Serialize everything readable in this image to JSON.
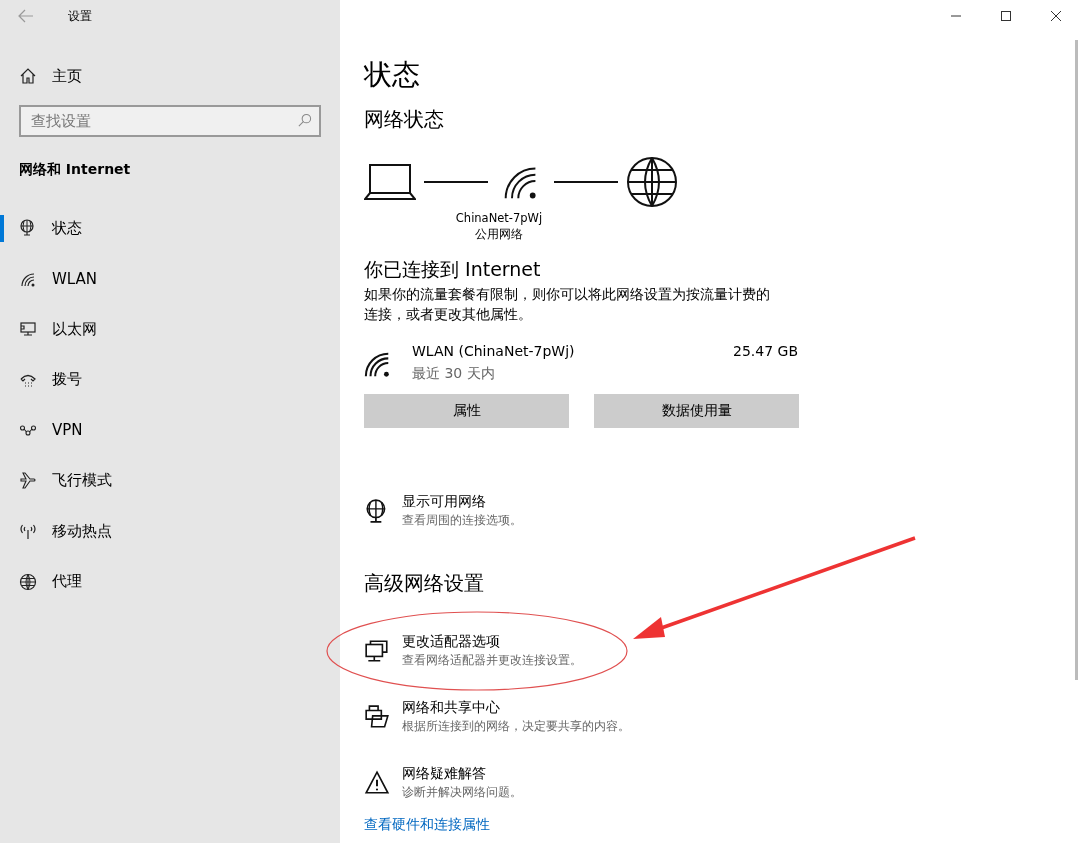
{
  "window": {
    "title": "设置"
  },
  "sidebar": {
    "home": "主页",
    "search": {
      "placeholder": "查找设置"
    },
    "section": "网络和 Internet",
    "items": [
      {
        "label": "状态",
        "kind": "status",
        "selected": true
      },
      {
        "label": "WLAN",
        "kind": "wlan",
        "selected": false
      },
      {
        "label": "以太网",
        "kind": "ethernet",
        "selected": false
      },
      {
        "label": "拨号",
        "kind": "dialup",
        "selected": false
      },
      {
        "label": "VPN",
        "kind": "vpn",
        "selected": false
      },
      {
        "label": "飞行模式",
        "kind": "airplane",
        "selected": false
      },
      {
        "label": "移动热点",
        "kind": "hotspot",
        "selected": false
      },
      {
        "label": "代理",
        "kind": "proxy",
        "selected": false
      }
    ]
  },
  "main": {
    "title": "状态",
    "network_status": {
      "heading": "网络状态",
      "network_name": "ChinaNet-7pWj",
      "network_type": "公用网络"
    },
    "connected": {
      "heading": "你已连接到 Internet",
      "description": "如果你的流量套餐有限制，则你可以将此网络设置为按流量计费的连接，或者更改其他属性。"
    },
    "usage": {
      "name": "WLAN (ChinaNet-7pWj)",
      "period": "最近 30 天内",
      "amount": "25.47 GB"
    },
    "buttons": [
      "属性",
      "数据使用量"
    ],
    "show_networks": {
      "kind": "globe",
      "title": "显示可用网络",
      "subtitle": "查看周围的连接选项。"
    },
    "advanced": {
      "heading": "高级网络设置",
      "items": [
        {
          "kind": "adapter",
          "title": "更改适配器选项",
          "subtitle": "查看网络适配器并更改连接设置。"
        },
        {
          "kind": "sharing",
          "title": "网络和共享中心",
          "subtitle": "根据所连接到的网络，决定要共享的内容。"
        },
        {
          "kind": "warning",
          "title": "网络疑难解答",
          "subtitle": "诊断并解决网络问题。"
        }
      ]
    },
    "link": "查看硬件和连接属性"
  }
}
